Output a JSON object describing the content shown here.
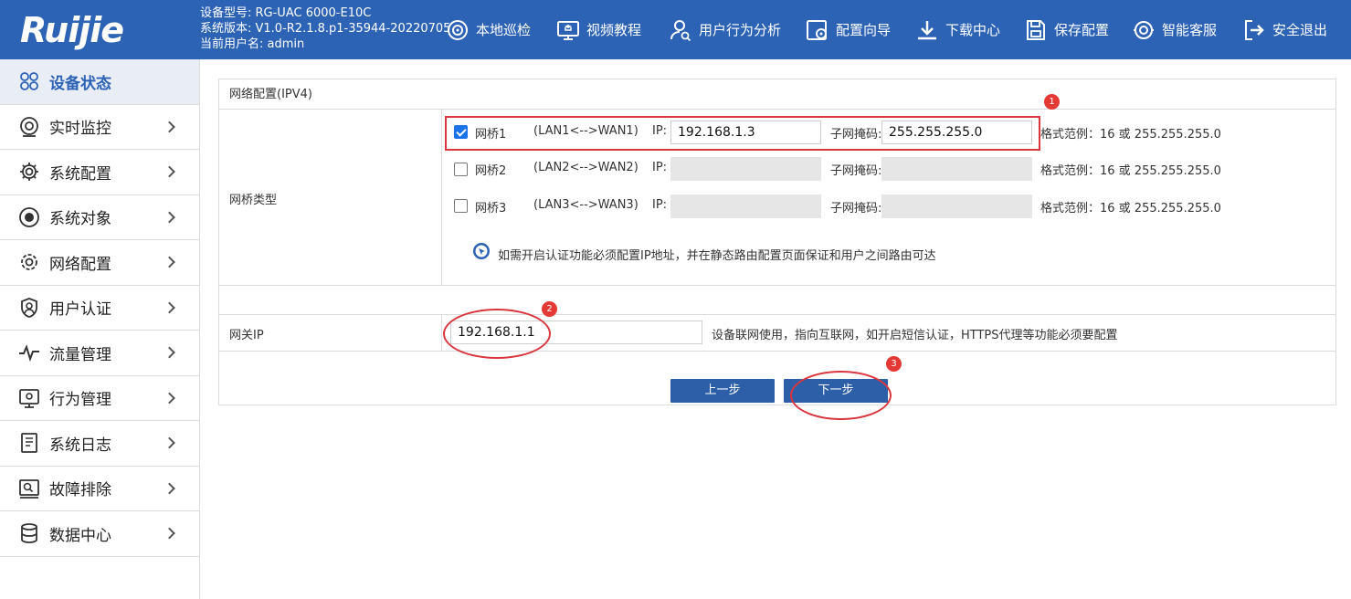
{
  "header": {
    "logo_text": "Ruijie",
    "device_model": "设备型号: RG-UAC 6000-E10C",
    "system_version": "系统版本: V1.0-R2.1.8.p1-35944-20220705",
    "current_user": "当前用户名: admin",
    "nav": [
      {
        "label": "本地巡检",
        "icon": "inspect-icon"
      },
      {
        "label": "视频教程",
        "icon": "video-tutorial-icon"
      },
      {
        "label": "用户行为分析",
        "icon": "user-analysis-icon"
      },
      {
        "label": "配置向导",
        "icon": "config-wizard-icon"
      },
      {
        "label": "下载中心",
        "icon": "download-icon"
      },
      {
        "label": "保存配置",
        "icon": "save-icon"
      },
      {
        "label": "智能客服",
        "icon": "support-icon"
      },
      {
        "label": "安全退出",
        "icon": "logout-icon"
      }
    ]
  },
  "sidebar": {
    "items": [
      {
        "label": "设备状态",
        "icon": "device-status-icon",
        "active": true
      },
      {
        "label": "实时监控",
        "icon": "monitor-icon"
      },
      {
        "label": "系统配置",
        "icon": "gear-icon"
      },
      {
        "label": "系统对象",
        "icon": "object-icon"
      },
      {
        "label": "网络配置",
        "icon": "network-gear-icon"
      },
      {
        "label": "用户认证",
        "icon": "user-shield-icon"
      },
      {
        "label": "流量管理",
        "icon": "pulse-icon"
      },
      {
        "label": "行为管理",
        "icon": "behavior-icon"
      },
      {
        "label": "系统日志",
        "icon": "log-icon"
      },
      {
        "label": "故障排除",
        "icon": "troubleshoot-icon"
      },
      {
        "label": "数据中心",
        "icon": "database-icon"
      }
    ]
  },
  "panel": {
    "title": "网络配置(IPV4)",
    "bridge_type_label": "网桥类型",
    "bridges": [
      {
        "name": "网桥1",
        "mapping": "(LAN1<-->WAN1)",
        "ip_label": "IP:",
        "ip": "192.168.1.3",
        "mask_label": "子网掩码:",
        "mask": "255.255.255.0",
        "hint": "格式范例：16 或 255.255.255.0",
        "checked": true
      },
      {
        "name": "网桥2",
        "mapping": "(LAN2<-->WAN2)",
        "ip_label": "IP:",
        "ip": "",
        "mask_label": "子网掩码:",
        "mask": "",
        "hint": "格式范例：16 或 255.255.255.0",
        "checked": false
      },
      {
        "name": "网桥3",
        "mapping": "(LAN3<-->WAN3)",
        "ip_label": "IP:",
        "ip": "",
        "mask_label": "子网掩码:",
        "mask": "",
        "hint": "格式范例：16 或 255.255.255.0",
        "checked": false
      }
    ],
    "notice": "如需开启认证功能必须配置IP地址，并在静态路由配置页面保证和用户之间路由可达",
    "gateway_label": "网关IP",
    "gateway_value": "192.168.1.1",
    "gateway_hint": "设备联网使用，指向互联网，如开启短信认证，HTTPS代理等功能必须要配置",
    "prev_button": "上一步",
    "next_button": "下一步"
  },
  "annotations": {
    "badge1": "1",
    "badge2": "2",
    "badge3": "3",
    "color": "#d9363e"
  },
  "colors": {
    "header_bg": "#2d63b5",
    "button_bg": "#2d5fa8",
    "active_menu_bg": "#e8edf6"
  }
}
